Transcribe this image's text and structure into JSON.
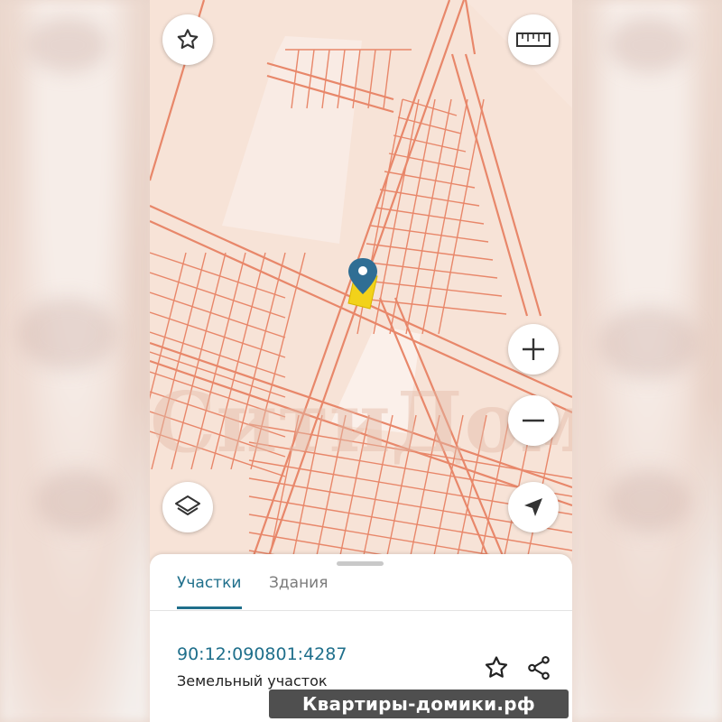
{
  "map": {
    "watermark": "СитиДом"
  },
  "controls": {
    "favorite_icon": "star-outline-icon",
    "ruler_icon": "ruler-icon",
    "zoom_in_icon": "plus-icon",
    "zoom_out_icon": "minus-icon",
    "layers_icon": "layers-icon",
    "locate_icon": "navigation-arrow-icon"
  },
  "bottom_sheet": {
    "tabs": [
      {
        "label": "Участки",
        "active": true
      },
      {
        "label": "Здания",
        "active": false
      }
    ],
    "parcel": {
      "cadastral_number": "90:12:090801:4287",
      "type": "Земельный участок"
    }
  },
  "site_watermark": {
    "text": "Квартиры-домики.рф"
  },
  "colors": {
    "accent": "#1f6f8b",
    "parcel_line": "#e8876a",
    "map_bg": "#f7e3d7",
    "selected_parcel": "#f2d21a",
    "marker": "#2f6e94"
  }
}
